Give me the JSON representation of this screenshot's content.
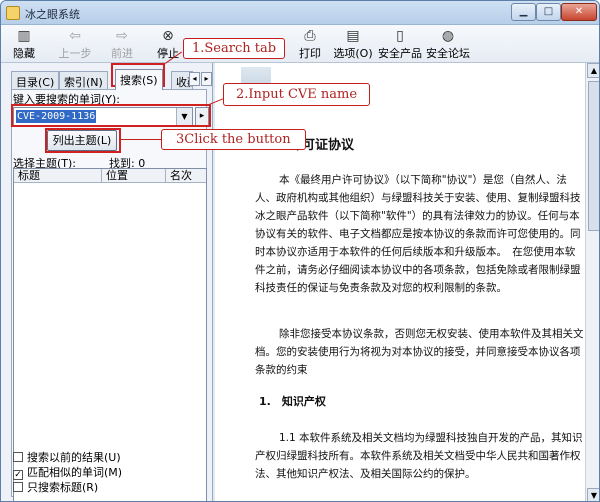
{
  "window": {
    "title": "冰之眼系统"
  },
  "toolbar": {
    "items": [
      {
        "label": "隐藏",
        "icon": "hide-icon"
      },
      {
        "label": "上一步",
        "icon": "back-icon"
      },
      {
        "label": "前进",
        "icon": "forward-icon"
      },
      {
        "label": "停止",
        "icon": "stop-icon"
      },
      {
        "label": "打印",
        "icon": "print-icon"
      },
      {
        "label": "选项(O)",
        "icon": "options-icon"
      },
      {
        "label": "安全产品",
        "icon": "document-icon"
      },
      {
        "label": "安全论坛",
        "icon": "globe-icon"
      }
    ]
  },
  "tabs": [
    {
      "label": "目录(C)"
    },
    {
      "label": "索引(N)"
    },
    {
      "label": "搜索(S)"
    },
    {
      "label": "收藏"
    }
  ],
  "search": {
    "input_label": "键入要搜索的单词(Y):",
    "query": "CVE-2009-1136",
    "list_topics_label": "列出主题(L)",
    "select_topic_label": "选择主题(T):",
    "found_label": "找到: 0",
    "columns": [
      "标题",
      "位置",
      "名次"
    ],
    "options": [
      {
        "label": "搜索以前的结果(U)",
        "checked": false
      },
      {
        "label": "匹配相似的单词(M)",
        "checked": true
      },
      {
        "label": "只搜索标题(R)",
        "checked": false
      }
    ]
  },
  "document": {
    "title": "许可证协议",
    "paragraphs": [
      "本《最终用户许可协议》（以下简称\"协议\"）是您（自然人、法人、政府机构或其他组织）与绿盟科技关于安装、使用、复制绿盟科技冰之眼产品软件（以下简称\"软件\"）的具有法律效力的协议。任何与本协议有关的软件、电子文档都应是按本协议的条款而许可您使用的。同时本协议亦适用于本软件的任何后续版本和升级版本。　在您使用本软件之前，请务必仔细阅读本协议中的各项条款，包括免除或者限制绿盟科技责任的保证与免责条款及对您的权利限制的条款。",
      "除非您接受本协议条款，否则您无权安装、使用本软件及其相关文档。您的安装使用行为将视为对本协议的接受，并同意接受本协议各项条款的约束",
      "1.1 本软件系统及相关文档均为绿盟科技独自开发的产品，其知识产权归绿盟科技所有。本软件系统及相关文档受中华人民共和国著作权法、其他知识产权法、及相关国际公约的保护。"
    ],
    "section_heading": "1.　知识产权"
  },
  "annotations": {
    "step1": "1.Search tab",
    "step2": "2.Input CVE name",
    "step3": "3Click the button",
    "color": "#c61d1d"
  }
}
